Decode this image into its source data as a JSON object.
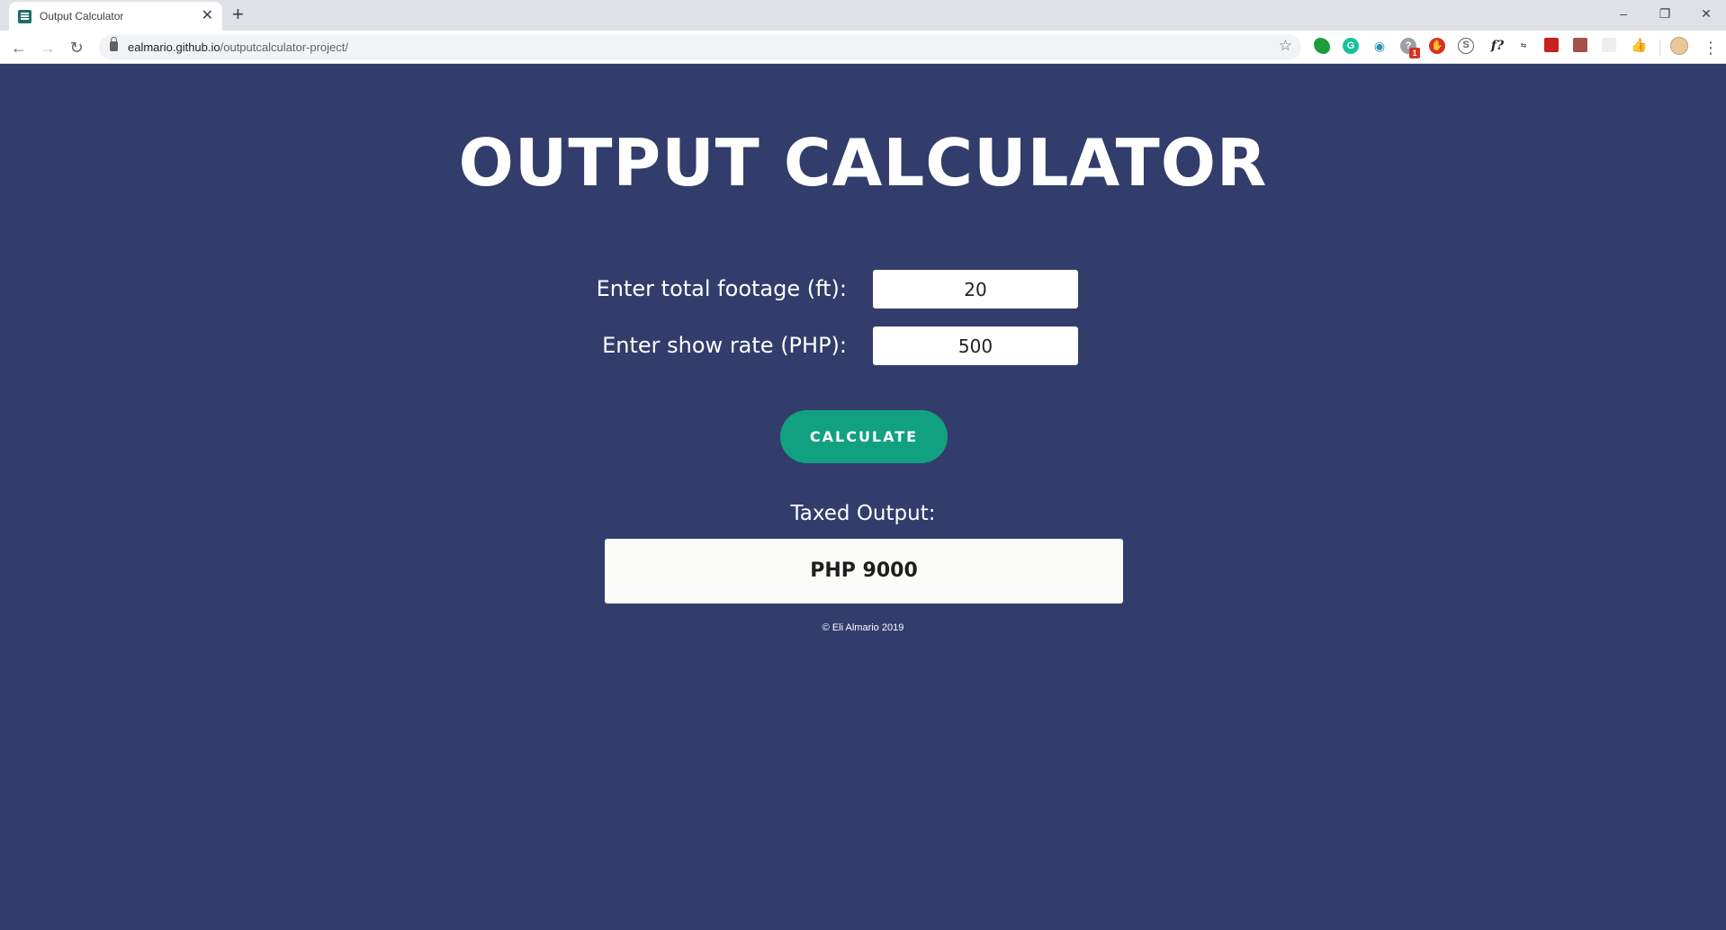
{
  "browser": {
    "tab_title": "Output Calculator",
    "tab_close": "✕",
    "new_tab": "+",
    "url_domain": "ealmario.github.io",
    "url_path": "/outputcalculator-project/",
    "window_controls": {
      "minimize": "–",
      "restore": "❐",
      "close": "✕"
    },
    "extension_badge": "1",
    "extension_f_label": "f?"
  },
  "page": {
    "title": "OUTPUT CALCULATOR",
    "footage_label": "Enter total footage (ft):",
    "footage_value": "20",
    "rate_label": "Enter show rate (PHP):",
    "rate_value": "500",
    "calculate_label": "CALCULATE",
    "output_label": "Taxed Output:",
    "output_value": "PHP 9000",
    "footer": "© Eli Almario 2019"
  }
}
